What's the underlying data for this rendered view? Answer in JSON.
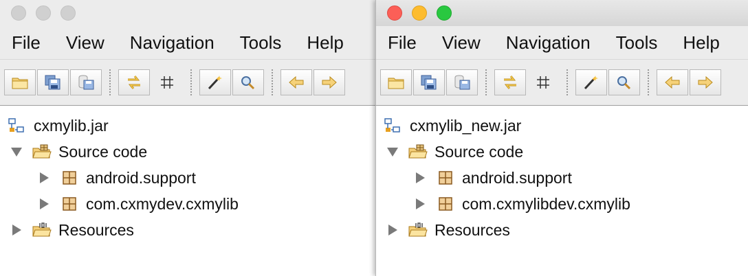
{
  "windows": [
    {
      "menu": [
        "File",
        "View",
        "Navigation",
        "Tools",
        "Help"
      ],
      "tree": {
        "root": "cxmylib.jar",
        "source_code": "Source code",
        "packages": [
          "android.support",
          "com.cxmydev.cxmylib"
        ],
        "resources": "Resources"
      }
    },
    {
      "menu": [
        "File",
        "View",
        "Navigation",
        "Tools",
        "Help"
      ],
      "tree": {
        "root": "cxmylib_new.jar",
        "source_code": "Source code",
        "packages": [
          "android.support",
          "com.cxmylibdev.cxmylib"
        ],
        "resources": "Resources"
      }
    }
  ],
  "icons": {
    "toolbar": [
      "open-file-icon",
      "save-all-icon",
      "save-icon",
      "sync-arrows-icon",
      "crosshair-grid-icon",
      "magic-wand-icon",
      "search-icon",
      "back-arrow-icon"
    ],
    "tree": [
      "jar-icon",
      "source-folder-icon",
      "package-icon",
      "resources-folder-icon"
    ]
  },
  "colors": {
    "accent_red": "#fc5f57",
    "accent_yellow": "#fdbc2e",
    "accent_green": "#29c840"
  }
}
